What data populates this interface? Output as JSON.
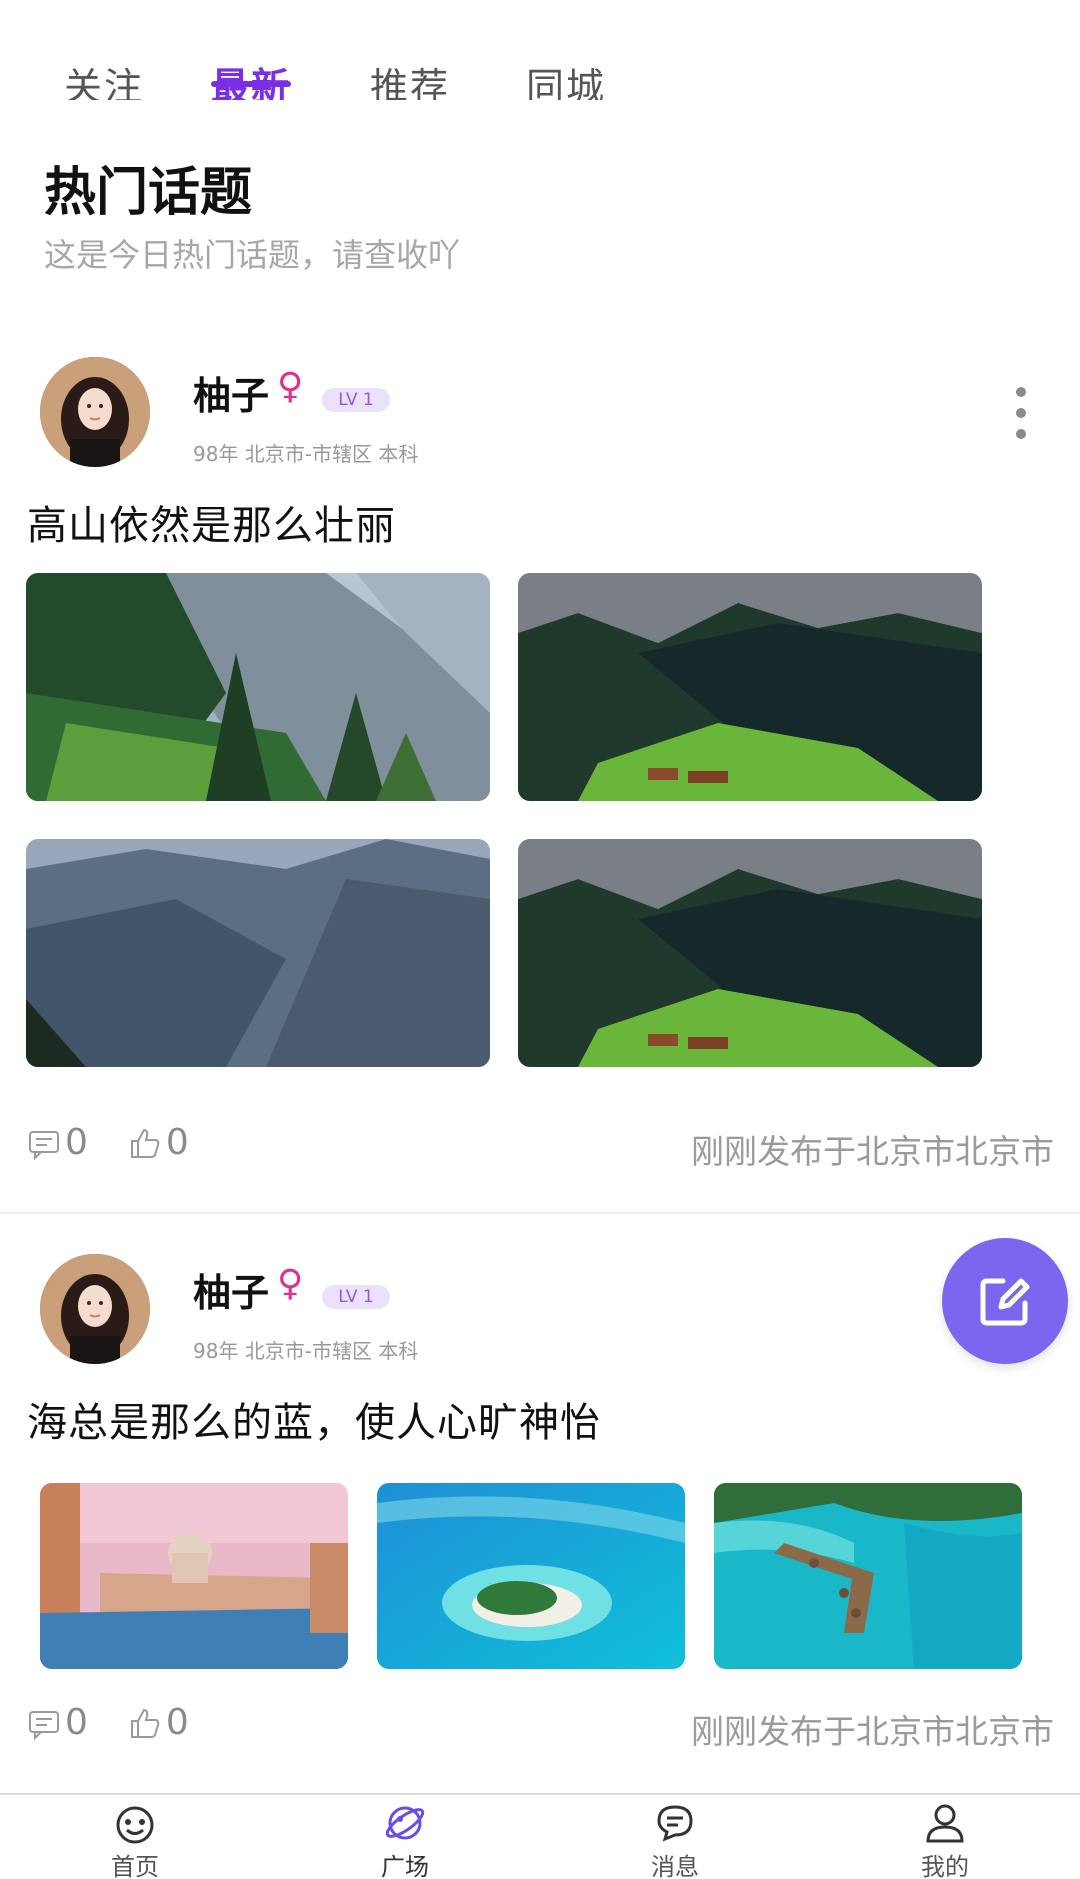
{
  "tabs": [
    {
      "label": "关注"
    },
    {
      "label": "最新"
    },
    {
      "label": "推荐"
    },
    {
      "label": "同城"
    }
  ],
  "active_tab": "最新",
  "hot_topics": {
    "title": "热门话题",
    "subtitle": "这是今日热门话题，请查收吖"
  },
  "posts": [
    {
      "user": {
        "name": "柚子",
        "gender_icon": "♀",
        "level": "LV 1",
        "meta": "98年 北京市-市辖区 本科"
      },
      "text": "高山依然是那么壮丽",
      "images": [
        "mountain-forest-cliff",
        "snowy-peaks-meadow",
        "misty-valley",
        "snowy-peaks-meadow"
      ],
      "comments": "0",
      "likes": "0",
      "publish_info": "刚刚发布于北京市北京市"
    },
    {
      "user": {
        "name": "柚子",
        "gender_icon": "♀",
        "level": "LV 1",
        "meta": "98年 北京市-市辖区 本科"
      },
      "text": "海总是那么的蓝，使人心旷神怡",
      "images": [
        "venice-canal",
        "tropical-island",
        "overwater-bungalows"
      ],
      "comments": "0",
      "likes": "0",
      "publish_info": "刚刚发布于北京市北京市"
    }
  ],
  "bottom_nav": [
    {
      "label": "首页",
      "icon": "smile-face-icon"
    },
    {
      "label": "广场",
      "icon": "planet-icon"
    },
    {
      "label": "消息",
      "icon": "chat-bubble-icon"
    },
    {
      "label": "我的",
      "icon": "user-icon"
    }
  ],
  "colors": {
    "accent": "#7b2ee8",
    "fab": "#7b66f0",
    "level_badge_bg": "#ece1fb",
    "gender": "#e2308a"
  }
}
